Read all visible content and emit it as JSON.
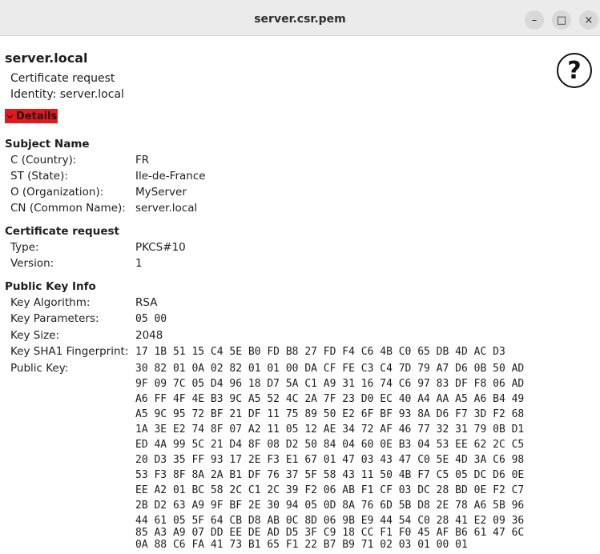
{
  "window": {
    "title": "server.csr.pem",
    "minimize_label": "–",
    "maximize_label": "□",
    "close_label": "×"
  },
  "header": {
    "heading": "server.local",
    "type_line": "Certificate request",
    "identity_line": "Identity: server.local",
    "help_label": "?"
  },
  "details_toggle": {
    "label": "Details",
    "icon": "chevron-down-icon",
    "color": "#e6171c"
  },
  "subject": {
    "title": "Subject Name",
    "c_label": "C (Country):",
    "c_value": "FR",
    "st_label": "ST (State):",
    "st_value": "Ile-de-France",
    "o_label": "O (Organization):",
    "o_value": "MyServer",
    "cn_label": "CN (Common Name):",
    "cn_value": "server.local"
  },
  "request": {
    "title": "Certificate request",
    "type_label": "Type:",
    "type_value": "PKCS#10",
    "version_label": "Version:",
    "version_value": "1"
  },
  "pubkey": {
    "title": "Public Key Info",
    "alg_label": "Key Algorithm:",
    "alg_value": "RSA",
    "params_label": "Key Parameters:",
    "params_value": "05 00",
    "size_label": "Key Size:",
    "size_value": "2048",
    "sha1_label": "Key SHA1 Fingerprint:",
    "sha1_value": "17 1B 51 15 C4 5E B0 FD B8 27 FD F4 C6 4B C0 65 DB 4D AC D3",
    "key_label": "Public Key:",
    "key_lines": [
      "30 82 01 0A 02 82 01 01 00 DA CF FE C3 C4 7D 79 A7 D6 0B 50 AD",
      "9F 09 7C 05 D4 96 18 D7 5A C1 A9 31 16 74 C6 97 83 DF F8 06 AD",
      "A6 FF 4F 4E B3 9C A5 52 4C 2A 7F 23 D0 EC 40 A4 AA A5 A6 B4 49",
      "A5 9C 95 72 BF 21 DF 11 75 89 50 E2 6F BF 93 8A D6 F7 3D F2 68",
      "1A 3E E2 74 8F 07 A2 11 05 12 AE 34 72 AF 46 77 32 31 79 0B D1",
      "ED 4A 99 5C 21 D4 8F 08 D2 50 84 04 60 0E B3 04 53 EE 62 2C C5",
      "20 D3 35 FF 93 17 2E F3 E1 67 01 47 03 43 47 C0 5E 4D 3A C6 98",
      "53 F3 8F 8A 2A B1 DF 76 37 5F 58 43 11 50 4B F7 C5 05 DC D6 0E",
      "EE A2 01 BC 58 2C C1 2C 39 F2 06 AB F1 CF 03 DC 28 BD 0E F2 C7",
      "2B D2 63 A9 9F BF 2E 30 94 05 0D 8A 76 6D 5B D8 2E 78 A6 5B 96",
      "44 61 05 5F 64 CB D8 AB 0C 8D 06 9B E9 44 54 C0 28 41 E2 09 36",
      "85 A3 A9 07 DD EE DE AD D5 3F C9 18 CC F1 F0 45 AF B6 61 47 6C",
      "0A 88 C6 FA 41 73 B1 65 F1 22 B7 B9 71 02 03 01 00 01"
    ]
  }
}
